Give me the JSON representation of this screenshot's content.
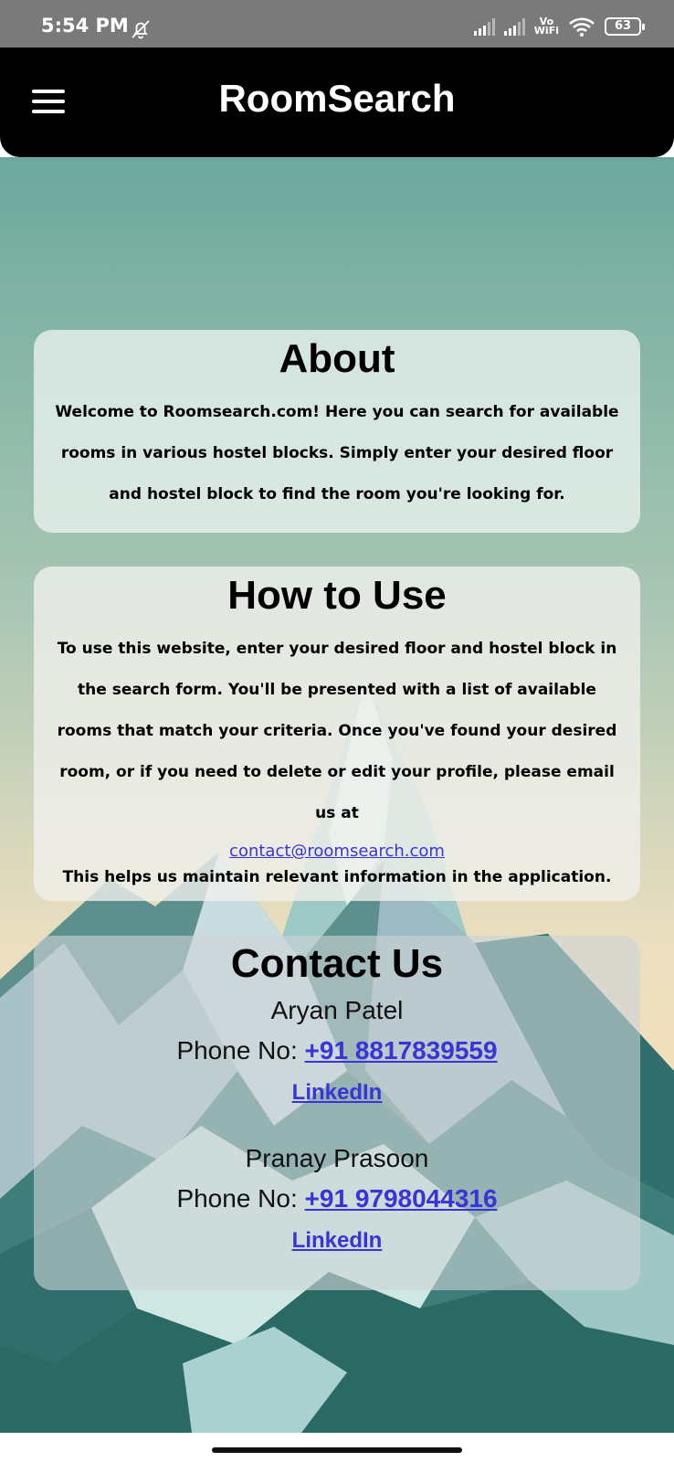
{
  "status_bar": {
    "time": "5:54 PM",
    "vowifi_top": "Vo",
    "vowifi_bottom": "WiFi",
    "battery": "63",
    "icons": [
      "bell-off-icon",
      "signal-icon",
      "signal-icon",
      "vowifi-icon",
      "wifi-icon",
      "battery-icon"
    ]
  },
  "app_bar": {
    "title": "RoomSearch",
    "menu_icon": "hamburger-menu-icon"
  },
  "about": {
    "heading": "About",
    "text": "Welcome to Roomsearch.com! Here you can search for available rooms in various hostel blocks. Simply enter your desired floor and hostel block to find the room you're looking for."
  },
  "how_to_use": {
    "heading": "How to Use",
    "text": "To use this website, enter your desired floor and hostel block in the search form. You'll be presented with a list of available rooms that match your criteria. Once you've found your desired room, or if you need to delete or edit your profile, please email us at",
    "email": "contact@roomsearch.com",
    "after_text": "This helps us maintain relevant information in the application."
  },
  "contact_us": {
    "heading": "Contact Us",
    "people": [
      {
        "name": "Aryan Patel",
        "phone_label": "Phone No:",
        "phone": "+91 8817839559",
        "link": "LinkedIn"
      },
      {
        "name": "Pranay Prasoon",
        "phone_label": "Phone No:",
        "phone": "+91 9798044316",
        "link": "LinkedIn"
      }
    ]
  },
  "colors": {
    "app_bar": "#000000",
    "link": "#3a34d6",
    "sky_top": "#6fa89c",
    "sky_bottom": "#f3e6c6",
    "mountain_dark": "#2f6e6a",
    "mountain_light": "#d6ece9"
  }
}
